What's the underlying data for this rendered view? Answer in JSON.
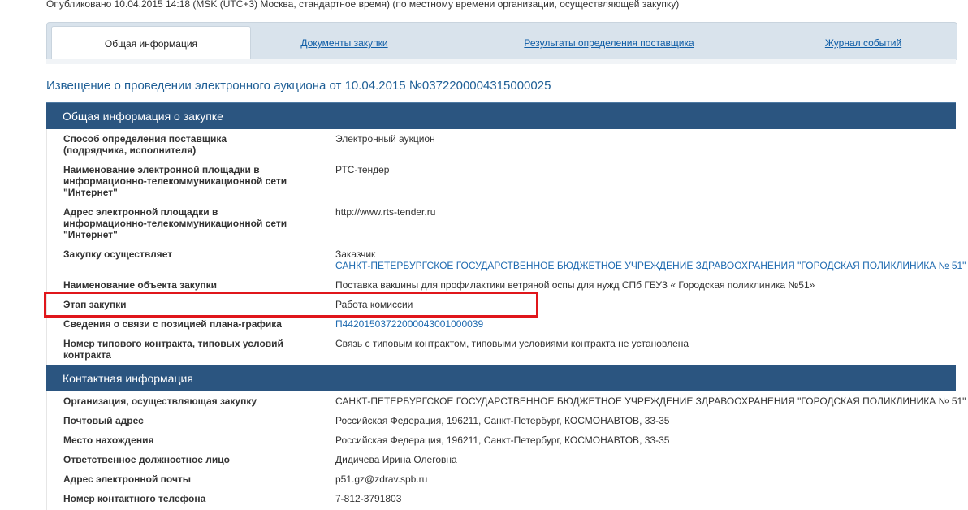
{
  "header": {
    "published": "Опубликовано 10.04.2015 14:18 (MSK (UTC+3) Москва, стандартное время) (по местному времени организации, осуществляющей закупку)"
  },
  "tabs": [
    {
      "label": "Общая информация",
      "active": true
    },
    {
      "label": "Документы закупки",
      "active": false
    },
    {
      "label": "Результаты определения поставщика",
      "active": false
    },
    {
      "label": "Журнал событий",
      "active": false
    }
  ],
  "notice_title": "Извещение о проведении электронного аукциона от 10.04.2015 №0372200004315000025",
  "general": {
    "title": "Общая информация о закупке",
    "rows": [
      {
        "label": "Способ определения поставщика (подрядчика, исполнителя)",
        "value": "Электронный аукцион"
      },
      {
        "label": "Наименование электронной площадки в информационно-телекоммуникационной сети \"Интернет\"",
        "value": "РТС-тендер"
      },
      {
        "label": "Адрес электронной площадки в информационно-телекоммуникационной сети \"Интернет\"",
        "value": "http://www.rts-tender.ru"
      },
      {
        "label": "Закупку осуществляет",
        "value": "Заказчик",
        "value2": "САНКТ-ПЕТЕРБУРГСКОЕ ГОСУДАРСТВЕННОЕ БЮДЖЕТНОЕ УЧРЕЖДЕНИЕ ЗДРАВООХРАНЕНИЯ \"ГОРОДСКАЯ ПОЛИКЛИНИКА № 51\""
      },
      {
        "label": "Наименование объекта закупки",
        "value": "Поставка вакцины для профилактики ветряной оспы для нужд СПб ГБУЗ « Городская поликлиника №51»"
      },
      {
        "label": "Этап закупки",
        "value": "Работа комиссии"
      },
      {
        "label": "Сведения о связи с позицией плана-графика",
        "value": "П44201503722000043001000039"
      },
      {
        "label": "Номер типового контракта, типовых условий контракта",
        "value": "Связь с типовым контрактом, типовыми условиями контракта не установлена"
      }
    ]
  },
  "contacts": {
    "title": "Контактная информация",
    "rows": [
      {
        "label": "Организация, осуществляющая закупку",
        "value": "САНКТ-ПЕТЕРБУРГСКОЕ ГОСУДАРСТВЕННОЕ БЮДЖЕТНОЕ УЧРЕЖДЕНИЕ ЗДРАВООХРАНЕНИЯ \"ГОРОДСКАЯ ПОЛИКЛИНИКА № 51\""
      },
      {
        "label": "Почтовый адрес",
        "value": "Российская Федерация, 196211, Санкт-Петербург, КОСМОНАВТОВ, 33-35"
      },
      {
        "label": "Место нахождения",
        "value": "Российская Федерация, 196211, Санкт-Петербург, КОСМОНАВТОВ, 33-35"
      },
      {
        "label": "Ответственное должностное лицо",
        "value": "Дидичева Ирина Олеговна"
      },
      {
        "label": "Адрес электронной почты",
        "value": "p51.gz@zdrav.spb.ru"
      },
      {
        "label": "Номер контактного телефона",
        "value": "7-812-3791803"
      }
    ]
  }
}
